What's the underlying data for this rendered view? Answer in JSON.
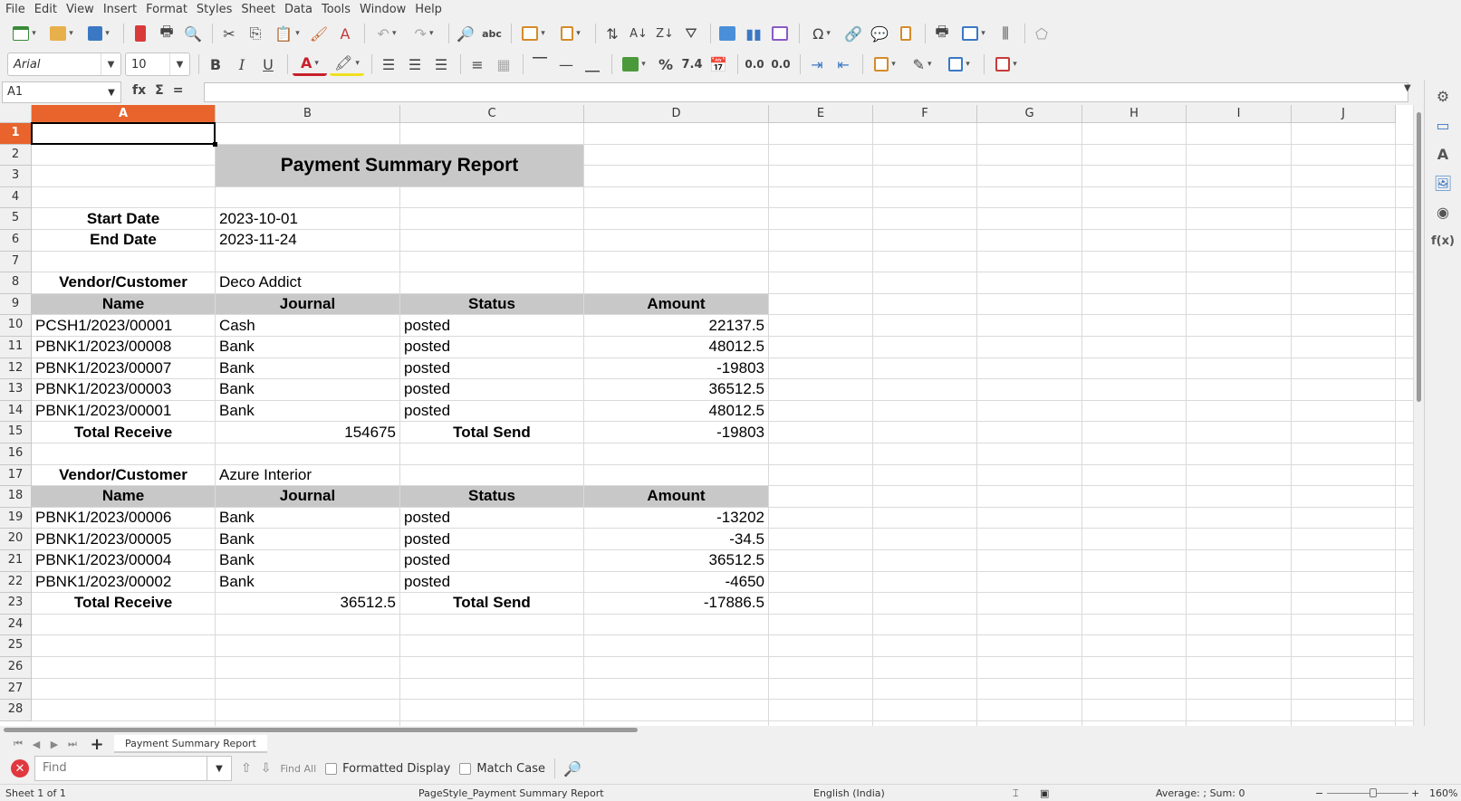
{
  "menu": [
    "File",
    "Edit",
    "View",
    "Insert",
    "Format",
    "Styles",
    "Sheet",
    "Data",
    "Tools",
    "Window",
    "Help"
  ],
  "font": {
    "name": "Arial",
    "size": "10"
  },
  "namebox": "A1",
  "formula": {
    "fx": "fx",
    "sum": "Σ",
    "eq": "="
  },
  "columns": [
    "A",
    "B",
    "C",
    "D",
    "E",
    "F",
    "G",
    "H",
    "I",
    "J"
  ],
  "rows": [
    "1",
    "2",
    "3",
    "4",
    "5",
    "6",
    "7",
    "8",
    "9",
    "10",
    "11",
    "12",
    "13",
    "14",
    "15",
    "16",
    "17",
    "18",
    "19",
    "20",
    "21",
    "22",
    "23",
    "24",
    "25",
    "26",
    "27",
    "28"
  ],
  "report": {
    "title": "Payment Summary Report",
    "start_label": "Start Date",
    "start_value": "2023-10-01",
    "end_label": "End Date",
    "end_value": "2023-11-24",
    "vc_label": "Vendor/Customer",
    "headers": [
      "Name",
      "Journal",
      "Status",
      "Amount"
    ],
    "total_receive_label": "Total Receive",
    "total_send_label": "Total Send",
    "groups": [
      {
        "vendor": "Deco Addict",
        "rows": [
          [
            "PCSH1/2023/00001",
            "Cash",
            "posted",
            "22137.5"
          ],
          [
            "PBNK1/2023/00008",
            "Bank",
            "posted",
            "48012.5"
          ],
          [
            "PBNK1/2023/00007",
            "Bank",
            "posted",
            "-19803"
          ],
          [
            "PBNK1/2023/00003",
            "Bank",
            "posted",
            "36512.5"
          ],
          [
            "PBNK1/2023/00001",
            "Bank",
            "posted",
            "48012.5"
          ]
        ],
        "total_receive": "154675",
        "total_send": "-19803"
      },
      {
        "vendor": "Azure Interior",
        "rows": [
          [
            "PBNK1/2023/00006",
            "Bank",
            "posted",
            "-13202"
          ],
          [
            "PBNK1/2023/00005",
            "Bank",
            "posted",
            "-34.5"
          ],
          [
            "PBNK1/2023/00004",
            "Bank",
            "posted",
            "36512.5"
          ],
          [
            "PBNK1/2023/00002",
            "Bank",
            "posted",
            "-4650"
          ]
        ],
        "total_receive": "36512.5",
        "total_send": "-17886.5"
      }
    ]
  },
  "sheet_tab": "Payment Summary Report",
  "find": {
    "placeholder": "Find",
    "find_all": "Find All",
    "formatted_display": "Formatted Display",
    "match_case": "Match Case"
  },
  "status": {
    "sheet": "Sheet 1 of 1",
    "page_style": "PageStyle_Payment Summary Report",
    "language": "English (India)",
    "summary": "Average: ; Sum: 0",
    "zoom": "160%"
  },
  "colors": {
    "accent": "#e8642c",
    "header_fill": "#c8c8c8"
  }
}
